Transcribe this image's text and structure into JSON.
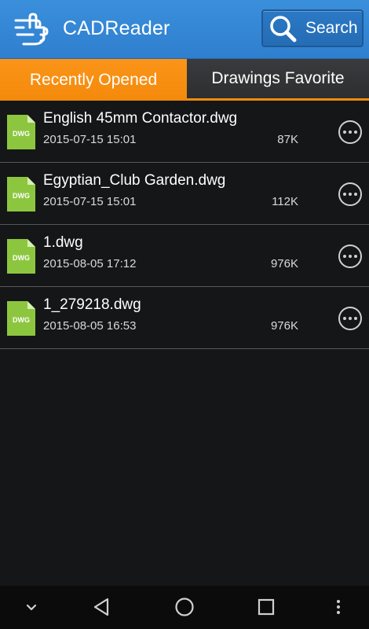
{
  "header": {
    "app_title": "CADReader",
    "search_label": "Search"
  },
  "tabs": [
    {
      "label": "Recently Opened",
      "active": true
    },
    {
      "label": "Drawings Favorite",
      "active": false
    }
  ],
  "file_icon_label": "DWG",
  "files": [
    {
      "name": "English 45mm Contactor.dwg",
      "date": "2015-07-15 15:01",
      "size": "87K"
    },
    {
      "name": "Egyptian_Club Garden.dwg",
      "date": "2015-07-15 15:01",
      "size": "112K"
    },
    {
      "name": "1.dwg",
      "date": "2015-08-05 17:12",
      "size": "976K"
    },
    {
      "name": "1_279218.dwg",
      "date": "2015-08-05 16:53",
      "size": "976K"
    }
  ],
  "colors": {
    "header_blue": "#2f7fcf",
    "tab_orange": "#f48a0c",
    "file_icon_green": "#8cc63f",
    "background": "#151618"
  },
  "icons": {
    "logo": "hand-pointer-icon",
    "search": "magnifier-icon",
    "more": "ellipsis-circle-icon",
    "nav": [
      "chevron-down-icon",
      "back-triangle-icon",
      "home-circle-icon",
      "recents-square-icon",
      "overflow-dots-icon"
    ]
  }
}
